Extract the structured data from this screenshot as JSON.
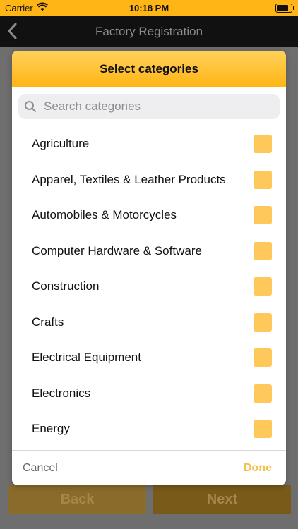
{
  "status_bar": {
    "carrier": "Carrier",
    "time": "10:18 PM"
  },
  "nav": {
    "title": "Factory Registration",
    "back_icon": "chevron-left-icon"
  },
  "bottom_buttons": {
    "back_label": "Back",
    "next_label": "Next"
  },
  "modal": {
    "title": "Select categories",
    "search_placeholder": "Search categories",
    "items": [
      {
        "label": "Agriculture",
        "checked": false
      },
      {
        "label": "Apparel, Textiles & Leather Products",
        "checked": false
      },
      {
        "label": "Automobiles & Motorcycles",
        "checked": false
      },
      {
        "label": "Computer Hardware & Software",
        "checked": false
      },
      {
        "label": "Construction",
        "checked": false
      },
      {
        "label": "Crafts",
        "checked": false
      },
      {
        "label": "Electrical Equipment",
        "checked": false
      },
      {
        "label": "Electronics",
        "checked": false
      },
      {
        "label": "Energy",
        "checked": false
      }
    ],
    "cancel_label": "Cancel",
    "done_label": "Done"
  },
  "colors": {
    "accent": "#ffb515",
    "checkbox": "#ffc85a",
    "done": "#f5c04a"
  }
}
